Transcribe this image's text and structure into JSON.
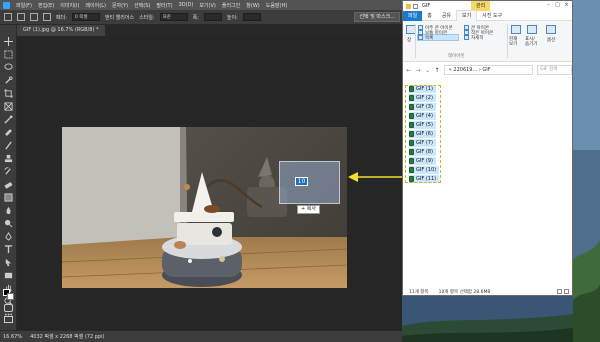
{
  "photoshop": {
    "menu": [
      "파일(F)",
      "편집(E)",
      "이미지(I)",
      "레이어(L)",
      "문자(Y)",
      "선택(S)",
      "필터(T)",
      "3D(D)",
      "보기(V)",
      "플러그인",
      "창(W)",
      "도움말(H)"
    ],
    "options": {
      "feather_label": "페더:",
      "feather_value": "0 픽셀",
      "antialias_label": "앤티 앨리어스",
      "style_label": "스타일:",
      "style_value": "표준",
      "width_label": "폭:",
      "height_label": "높이:",
      "select_mask_button": "선택 및 마스크..."
    },
    "doc_tab": "GIF (1).jpg @ 16.7% (RGB/8) *",
    "status": {
      "zoom": "16.67%",
      "doc_info": "4032 픽셀 x 2268 픽셀 (72 ppi)"
    },
    "drag": {
      "count": "10",
      "tooltip": "+ 복사"
    }
  },
  "explorer": {
    "title": "GIF",
    "manage_tab": "관리",
    "tabs": [
      "파일",
      "홈",
      "공유",
      "보기",
      "사진 도구"
    ],
    "ribbon": {
      "pane_label": "창",
      "layout": [
        "아주 큰 아이콘",
        "큰 아이콘",
        "보통 아이콘",
        "작은 아이콘",
        "목록",
        "자세히"
      ],
      "layout_group": "레이아웃",
      "current_view": "현재 보기",
      "show_hide": "표시/ 숨기기",
      "options": "옵션"
    },
    "address": "« 220619... › GIF",
    "search_placeholder": "GIF 검색",
    "files": [
      "GIF (1)",
      "GIF (2)",
      "GIF (3)",
      "GIF (4)",
      "GIF (5)",
      "GIF (6)",
      "GIF (7)",
      "GIF (8)",
      "GIF (9)",
      "GIF (10)",
      "GIF (11)"
    ],
    "status": {
      "count": "11개 항목",
      "selected": "10개 항목 선택함 28.6MB"
    }
  },
  "colors": {
    "callout": "#f0e030",
    "ps_bg": "#262626",
    "ps_panel": "#3c3c3c",
    "explorer_selected": "#cce8ff"
  }
}
